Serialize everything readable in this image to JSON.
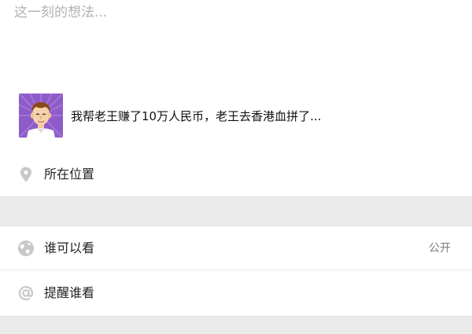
{
  "compose": {
    "placeholder": "这一刻的想法...",
    "value": ""
  },
  "share": {
    "thumbnail_icon": "cartoon-man-avatar",
    "title": "我帮老王赚了10万人民币，老王去香港血拼了..."
  },
  "options": {
    "location": {
      "icon": "location-pin-icon",
      "label": "所在位置"
    },
    "visibility": {
      "icon": "globe-icon",
      "label": "谁可以看",
      "value": "公开"
    },
    "remind": {
      "icon": "at-sign-icon",
      "label": "提醒谁看"
    }
  },
  "colors": {
    "background": "#ffffff",
    "separator": "#ebebeb",
    "icon": "#c8c8c8",
    "thumbnail_bg": "#8e5cc9"
  }
}
